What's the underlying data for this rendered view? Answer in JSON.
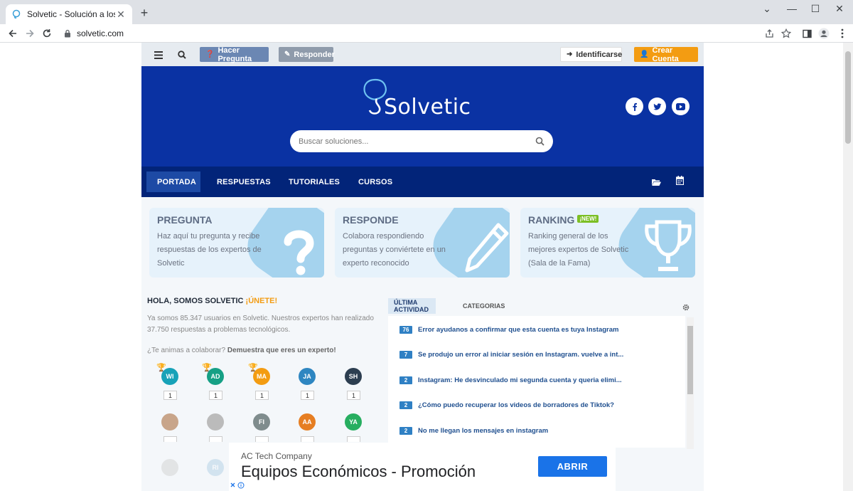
{
  "browser": {
    "tab_title": "Solvetic - Solución a los problem",
    "tab_close": "✕",
    "new_tab": "+",
    "url": "solvetic.com",
    "window_controls": [
      "⌄",
      "—",
      "☐",
      "✕"
    ]
  },
  "topbar": {
    "ask_button": "Hacer Pregunta",
    "answer_button": "Responder",
    "login_button": "Identificarse",
    "signup_button": "Crear Cuenta",
    "colors": {
      "ask": "#6b87b3",
      "answer": "#8f9bab",
      "signup": "#f39c12"
    }
  },
  "hero": {
    "logo": "Solvetic",
    "search_placeholder": "Buscar soluciones...",
    "social": [
      "facebook",
      "twitter",
      "youtube"
    ]
  },
  "nav": {
    "items": [
      {
        "label": "PORTADA"
      },
      {
        "label": "RESPUESTAS"
      },
      {
        "label": "TUTORIALES"
      },
      {
        "label": "CURSOS"
      }
    ]
  },
  "cards": [
    {
      "title": "PREGUNTA",
      "desc": "Haz aquí tu pregunta y recibe respuestas de los expertos de Solvetic"
    },
    {
      "title": "RESPONDE",
      "desc": "Colabora respondiendo preguntas y conviértete en un experto reconocido"
    },
    {
      "title": "RANKING",
      "badge": "¡NEW!",
      "desc": "Ranking general de los mejores expertos de Solvetic (Sala de la Fama)"
    }
  ],
  "welcome": {
    "title": "HOLA, SOMOS SOLVETIC",
    "join": "¡ÚNETE!",
    "intro": "Ya somos 85.347 usuarios en Solvetic. Nuestros expertos han realizado 37.750 respuestas a problemas tecnológicos.",
    "collab_prefix": "¿Te animas a colaborar?",
    "collab_link": "Demuestra que eres un experto!"
  },
  "experts_row1": [
    {
      "initials": "WI",
      "count": "1",
      "color": "#17a2b8",
      "trophy": "gold"
    },
    {
      "initials": "AD",
      "count": "1",
      "color": "#16a085",
      "trophy": "silver"
    },
    {
      "initials": "MA",
      "count": "1",
      "color": "#f39c12",
      "trophy": "bronze"
    },
    {
      "initials": "JA",
      "count": "1",
      "color": "#2e86c1"
    },
    {
      "initials": "SH",
      "count": "1",
      "color": "#2c3e50"
    }
  ],
  "experts_row2": [
    {
      "initials": "",
      "color": "#c8a58a"
    },
    {
      "initials": "",
      "color": "#bbbbbb"
    },
    {
      "initials": "FI",
      "color": "#7f8c8d"
    },
    {
      "initials": "AA",
      "color": "#e67e22"
    },
    {
      "initials": "YA",
      "color": "#27ae60"
    }
  ],
  "experts_row3": [
    {
      "initials": "",
      "color": "#cccccc"
    },
    {
      "initials": "RI",
      "color": "#a9cce3"
    }
  ],
  "activity": {
    "tabs": [
      "ÚLTIMA ACTIVIDAD",
      "CATEGORIAS"
    ],
    "items": [
      {
        "num": "76",
        "text": "Error ayudanos a confirmar que esta cuenta es tuya Instagram"
      },
      {
        "num": "7",
        "text": "Se produjo un error al iniciar sesión en Instagram. vuelve a int..."
      },
      {
        "num": "2",
        "text": "Instagram: He desvinculado mi segunda cuenta y queria elimi..."
      },
      {
        "num": "2",
        "text": "¿Cómo puedo recuperar los videos de borradores de Tiktok?"
      },
      {
        "num": "2",
        "text": "No me llegan los mensajes en instagram"
      }
    ]
  },
  "ad": {
    "advertiser": "AC Tech Company",
    "headline": "Equipos Económicos - Promoción",
    "cta": "ABRIR",
    "close": "X"
  }
}
